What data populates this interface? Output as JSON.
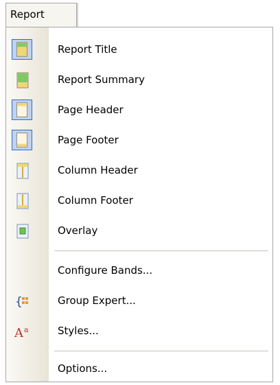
{
  "menu_bar": {
    "title": "Report"
  },
  "items": [
    {
      "label": "Report Title",
      "icon": "report-title-icon",
      "highlight": true
    },
    {
      "label": "Report Summary",
      "icon": "report-summary-icon",
      "highlight": false
    },
    {
      "label": "Page Header",
      "icon": "page-header-icon",
      "highlight": true
    },
    {
      "label": "Page Footer",
      "icon": "page-footer-icon",
      "highlight": true
    },
    {
      "label": "Column Header",
      "icon": "column-header-icon",
      "highlight": false
    },
    {
      "label": "Column Footer",
      "icon": "column-footer-icon",
      "highlight": false
    },
    {
      "label": "Overlay",
      "icon": "overlay-icon",
      "highlight": false
    },
    {
      "label": "Configure Bands...",
      "icon": "",
      "highlight": false
    },
    {
      "label": "Group Expert...",
      "icon": "group-expert-icon",
      "highlight": false
    },
    {
      "label": "Styles...",
      "icon": "styles-icon",
      "highlight": false
    },
    {
      "label": "Options...",
      "icon": "",
      "highlight": false
    }
  ],
  "colors": {
    "highlight_border": "#316ac5",
    "highlight_fill": "#c1d2ee",
    "band_green": "#6fc25a",
    "band_yellow": "#f2d675"
  }
}
